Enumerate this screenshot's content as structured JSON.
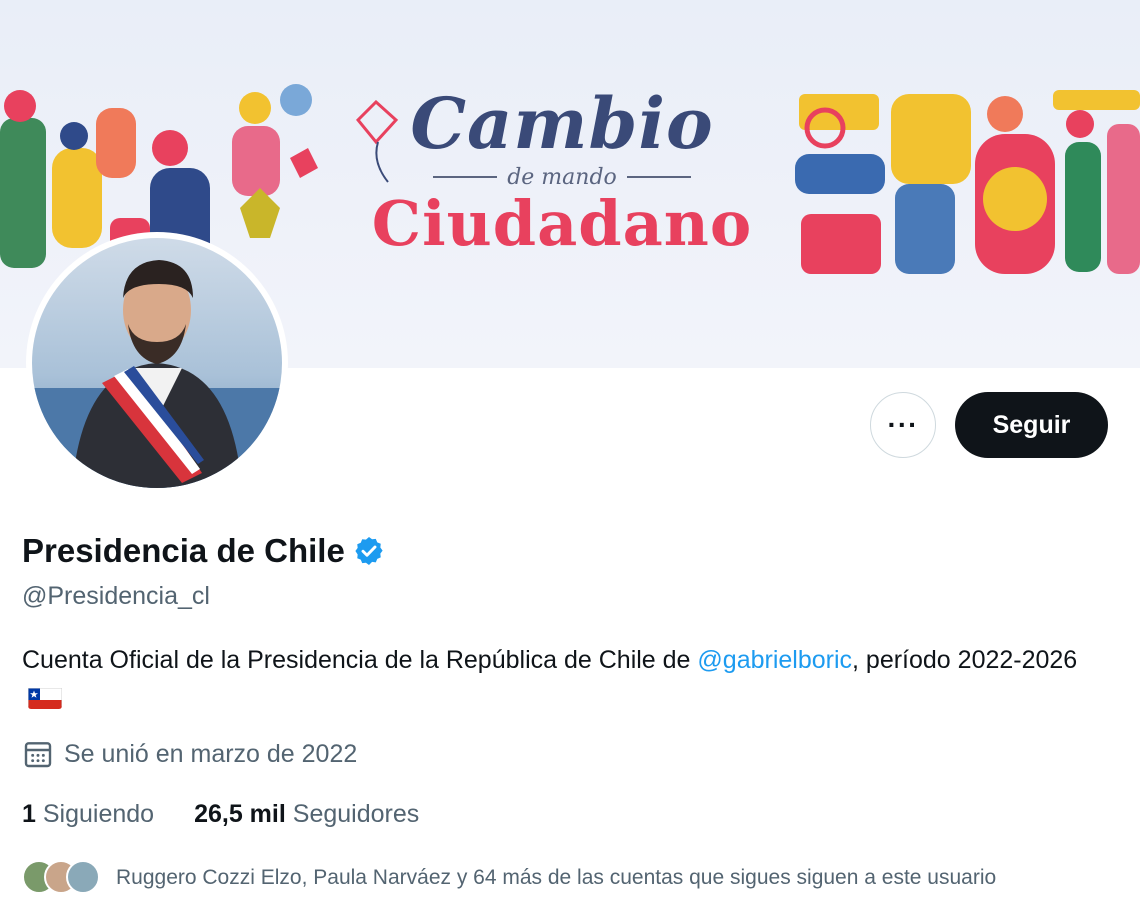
{
  "banner": {
    "line1": "Cambio",
    "line2": "de mando",
    "line3": "Ciudadano"
  },
  "profile": {
    "display_name": "Presidencia de Chile",
    "handle": "@Presidencia_cl",
    "verified_icon": "verified-badge-icon",
    "bio_prefix": "Cuenta Oficial de la Presidencia de la República de Chile de ",
    "bio_mention": "@gabrielboric",
    "bio_suffix": ", período 2022-2026",
    "bio_emoji": "chile-flag-icon",
    "joined": "Se unió en marzo de 2022"
  },
  "actions": {
    "more_label": "···",
    "follow_label": "Seguir"
  },
  "stats": {
    "following_count": "1",
    "following_label": "Siguiendo",
    "followers_count": "26,5 mil",
    "followers_label": "Seguidores"
  },
  "followers_you_know": {
    "text": "Ruggero Cozzi Elzo, Paula Narváez y 64 más de las cuentas que sigues siguen a este usuario"
  },
  "colors": {
    "accent": "#1d9bf0",
    "text_primary": "#0f1419",
    "text_secondary": "#536471",
    "button_dark": "#0f1419"
  }
}
